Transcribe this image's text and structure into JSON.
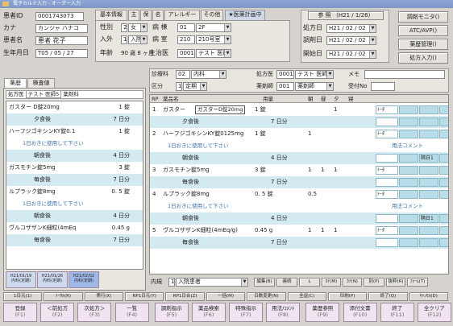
{
  "window": {
    "title": "電子カルテ入力 - オーダー入力"
  },
  "patient": {
    "id_label": "患者ID",
    "id": "0001743073",
    "kana_label": "カナ",
    "kana": "カンジャ ハナコ",
    "name_label": "患者名",
    "name": "患者 花子",
    "dob_label": "生年月日",
    "dob": "T05 / 05 / 27"
  },
  "info_tabs": [
    "基本情報",
    "主",
    "保",
    "名",
    "アレルギー",
    "その他"
  ],
  "dept_tab": "★医薬計画中",
  "info": {
    "sex_label": "性別",
    "sex_code": "2",
    "sex": "女",
    "adm_label": "入外",
    "adm_code": "1",
    "adm": "入院",
    "age_label": "年齢",
    "age": "90 歳 8 ヶ月",
    "ward_label": "病 棟",
    "ward_code": "01",
    "ward": "2F",
    "room_label": "病 室",
    "room_code": "210",
    "room": "210号室",
    "doc_label": "主治医",
    "doc_code": "00010",
    "doc": "テスト 医師5"
  },
  "dates": {
    "header": "参 照 （H21 / 1/26）",
    "rx_label": "処方日",
    "rx": "H21 / 02 / 02",
    "disp_label": "調剤日",
    "disp": "H21 / 02 / 02",
    "start_label": "開始日",
    "start": "H21 / 02 / 02"
  },
  "right_buttons": [
    "調剤モニタ()",
    "ATC/AVP()",
    "薬歴管理()",
    "処方入力()"
  ],
  "left_tabs": [
    "薬歴",
    "検査値"
  ],
  "left_filter": {
    "label": "処方医",
    "value": "テスト 医師5",
    "label2": "薬剤科"
  },
  "history": [
    {
      "name": "ガスター D錠20mg",
      "qty": "1 錠",
      "sub": "夕食後",
      "days": "7 日分"
    },
    {
      "name": "ハーフジゴキシンKY錠0.1",
      "qty": "1 錠",
      "note": "1日おきに使用して下さい",
      "sub": "朝食後",
      "days": "4 日分"
    },
    {
      "name": "ガスモチン錠5mg",
      "qty": "3 錠",
      "sub": "毎食後",
      "days": "7 日分"
    },
    {
      "name": "ルプラック錠8mg",
      "qty": "0. 5 錠",
      "note": "1日おきに使用して下さい",
      "sub": "朝食後",
      "days": "4 日分"
    },
    {
      "name": "ヴルコザザンK細粒(4mEq",
      "qty": "0.45 g",
      "sub": "毎食後",
      "days": "7 日分"
    }
  ],
  "left_bottom_tabs": [
    "H21/01/19\n内科(定期)",
    "H21/01/26\n内科(定期)",
    "H21/02/02\n内科(定期)"
  ],
  "order": {
    "dept_label": "診療科",
    "dept_code": "02",
    "dept": "内科",
    "div_label": "区分",
    "div_code": "1",
    "div": "定期",
    "doctor_label": "処方医",
    "doctor_code": "00010",
    "doctor": "テスト 医師5",
    "pharm_label": "薬剤師",
    "pharm_code": "001",
    "pharm": "薬剤師",
    "memo_label": "メモ",
    "recept_label": "受付No"
  },
  "grid_header": {
    "rp": "RP",
    "name": "薬品名",
    "qty": "用量",
    "m": "朝",
    "n": "昼",
    "e": "夕",
    "s": "寝"
  },
  "rows": [
    {
      "rp": "1",
      "name": "ガスター",
      "popup": "ガスターD錠20mg",
      "qty": "1 錠",
      "sub": "夕食後",
      "days": "7 日分",
      "e": "1",
      "c1": "ﾄｰﾀ"
    },
    {
      "rp": "2",
      "name": "ハーフジゴキシンKY錠0125mg",
      "qty": "1 錠",
      "m": "1",
      "note": "1日おきに使用して下さい",
      "sub": "朝食後",
      "days": "4 日分",
      "c1": "ﾄｰﾀ",
      "cm": "用法コメント",
      "cx": "隔日1"
    },
    {
      "rp": "3",
      "name": "ガスモチン錠5mg",
      "qty": "3 錠",
      "m": "1",
      "n": "1",
      "e": "1",
      "sub": "毎食後",
      "days": "7 日分",
      "c1": "ﾄｰﾀ"
    },
    {
      "rp": "4",
      "name": "ルプラック錠8mg",
      "qty": "0. 5 錠",
      "m": "0.5",
      "note": "1日おきに使用して下さい",
      "sub": "朝食後",
      "days": "4 日分",
      "c1": "ﾄｰﾀ",
      "cm": "用法コメント",
      "cx": "隔日1"
    },
    {
      "rp": "5",
      "name": "ヴルコザザンK細粒(4mEq/g)",
      "qty": "0.45 g",
      "m": "1",
      "n": "1",
      "e": "1",
      "sub": "毎食後",
      "days": "7 日分",
      "c1": "ﾄｰﾀ"
    }
  ],
  "status": {
    "label": "内規",
    "code": "1",
    "value": "入院患者"
  },
  "status_buttons": [
    "編集(B)",
    "連続",
    "L",
    "ｶﾅ(M)",
    "ｶﾅ(N)",
    "別(P)",
    "抜粋(R)",
    "ﾌｫｰﾑ(T)"
  ],
  "tool_buttons": [
    "1日元(1)",
    "ﾄｰﾀﾙ(R)",
    "実行(X)",
    "RP1日元(Y)",
    "RP1日合(Z)",
    "一括(M)",
    "日数変更(N)",
    "全返(C)",
    "印刷(P)",
    "終了(Q)",
    "ｷｬﾝｾﾙ(D)"
  ],
  "fkeys": [
    {
      "l1": "登録",
      "l2": "(F1)"
    },
    {
      "l1": "＜前処方",
      "l2": "(F2)"
    },
    {
      "l1": "次処方＞",
      "l2": "(F3)"
    },
    {
      "l1": "一覧",
      "l2": "(F4)"
    },
    {
      "l1": "調剤指示",
      "l2": "(F5)"
    },
    {
      "l1": "薬品検索",
      "l2": "(F6)"
    },
    {
      "l1": "特殊指示",
      "l2": "(F7)"
    },
    {
      "l1": "用法/ｺﾒﾝﾄ",
      "l2": "(F8)"
    },
    {
      "l1": "薬歴参照",
      "l2": "(F9)"
    },
    {
      "l1": "添付文書",
      "l2": "(F10)"
    },
    {
      "l1": "終了",
      "l2": "(F11)"
    },
    {
      "l1": "全クリア",
      "l2": "(F12)"
    }
  ]
}
